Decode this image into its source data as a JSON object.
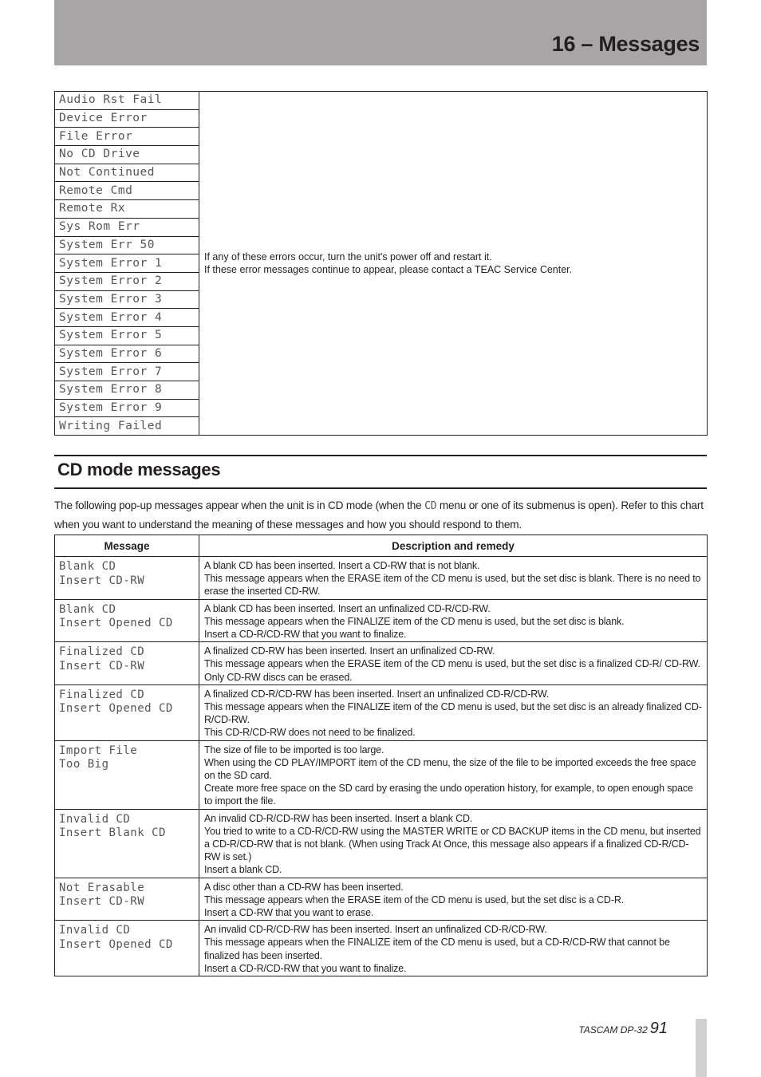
{
  "header": {
    "title": "16 – Messages"
  },
  "error_table": {
    "messages": [
      "Audio Rst Fail",
      "Device Error",
      "File Error",
      "No CD Drive",
      "Not Continued",
      "Remote Cmd",
      "Remote Rx",
      "Sys Rom Err",
      "System Err 50",
      "System Error 1",
      "System Error 2",
      "System Error 3",
      "System Error 4",
      "System Error 5",
      "System Error 6",
      "System Error 7",
      "System Error 8",
      "System Error 9",
      "Writing Failed"
    ],
    "description": [
      "If any of these errors occur, turn the unit's power off and restart it.",
      "If these error messages continue to appear, please contact a TEAC Service Center."
    ]
  },
  "section": {
    "title": "CD mode messages",
    "intro_part1": "The following pop-up messages appear when the unit is in CD mode (when the ",
    "intro_lcd": "CD",
    "intro_part2": " menu or one of its submenus is open). Refer to this chart when you want to understand the meaning of these messages and how you should respond to them."
  },
  "cd_table": {
    "headers": {
      "message": "Message",
      "description": "Description and remedy"
    },
    "rows": [
      {
        "message": [
          "Blank CD",
          "Insert CD-RW"
        ],
        "description": [
          "A blank CD has been inserted. Insert a CD-RW that is not blank.",
          "This message appears when the ERASE item of the CD menu is used, but the set disc is blank. There is no need to erase the inserted CD-RW."
        ]
      },
      {
        "message": [
          "Blank CD",
          "Insert Opened CD"
        ],
        "description": [
          "A blank CD has been inserted. Insert an unfinalized CD-R/CD-RW.",
          "This message appears when the FINALIZE item of the CD menu is used, but the set disc is blank.",
          "Insert a CD-R/CD-RW that you want to finalize."
        ]
      },
      {
        "message": [
          "Finalized CD",
          "Insert CD-RW"
        ],
        "description": [
          "A finalized CD-RW has been inserted. Insert an unfinalized CD-RW.",
          "This message appears when the ERASE item of the CD menu is used, but the set disc is a finalized CD-R/ CD-RW.",
          "Only CD-RW discs can be erased."
        ]
      },
      {
        "message": [
          "Finalized CD",
          "Insert Opened CD"
        ],
        "description": [
          "A finalized CD-R/CD-RW has been inserted. Insert an unfinalized CD-R/CD-RW.",
          "This message appears when the FINALIZE item of the CD menu is used, but the set disc is an already finalized CD-R/CD-RW.",
          "This CD-R/CD-RW does not need to be finalized."
        ]
      },
      {
        "message": [
          "Import File",
          "Too Big"
        ],
        "description": [
          "The size of file to be imported is too large.",
          "When using the CD PLAY/IMPORT item of the CD menu, the size of the file to be imported exceeds the free space on the SD card.",
          "Create more free space on the SD card by erasing the undo operation history, for example, to open enough space to import the file."
        ]
      },
      {
        "message": [
          "Invalid CD",
          "Insert Blank CD"
        ],
        "description": [
          "An invalid CD-R/CD-RW has been inserted. Insert a blank CD.",
          "You tried to write to a CD-R/CD-RW using the MASTER WRITE or CD BACKUP items in the CD menu, but inserted a CD-R/CD-RW that is not blank. (When using Track At Once, this message also appears if a finalized CD-R/CD-RW is set.)",
          "Insert a blank CD."
        ]
      },
      {
        "message": [
          "Not Erasable",
          "Insert CD-RW"
        ],
        "description": [
          "A disc other than a CD-RW has been inserted.",
          "This message appears when the ERASE item of the CD menu is used, but the set disc is a CD-R.",
          "Insert a CD-RW that you want to erase."
        ]
      },
      {
        "message": [
          "Invalid CD",
          "Insert Opened CD"
        ],
        "description": [
          "An invalid CD-R/CD-RW has been inserted. Insert an unfinalized CD-R/CD-RW.",
          "This message appears when the FINALIZE item of the CD menu is used, but a CD-R/CD-RW that cannot be finalized has been inserted.",
          "Insert a CD-R/CD-RW that you want to finalize."
        ]
      }
    ]
  },
  "footer": {
    "product": "TASCAM DP-32",
    "page_number": "91"
  }
}
